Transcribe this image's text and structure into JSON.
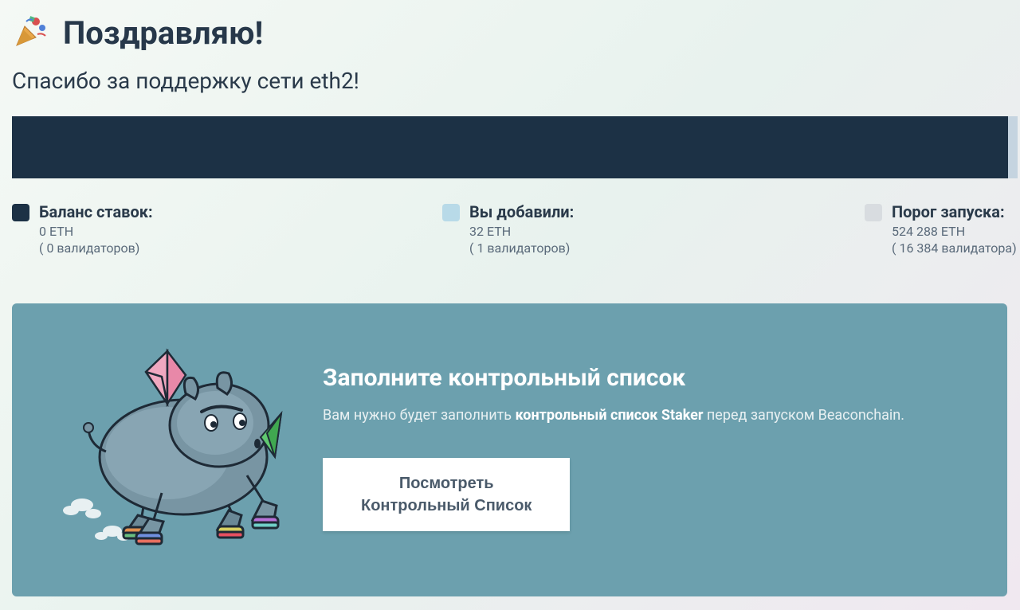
{
  "header": {
    "title": "Поздравляю!",
    "subtitle": "Спасибо за поддержку сети eth2!",
    "party_icon": "party-popper-icon"
  },
  "stats": {
    "balance": {
      "label": "Баланс ставок:",
      "value": "0 ETH",
      "detail": "( 0 валидаторов)"
    },
    "contributed": {
      "label": "Вы добавили:",
      "value": "32 ETH",
      "detail": "( 1 валидаторов)"
    },
    "threshold": {
      "label": "Порог запуска:",
      "value": "524 288 ETH",
      "detail": "( 16 384 валидатора)"
    }
  },
  "checklist": {
    "title": "Заполните контрольный список",
    "desc_prefix": "Вам нужно будет заполнить ",
    "desc_bold": "контрольный список Staker",
    "desc_suffix": " перед запуском Beaconchain.",
    "button_line1": "Посмотреть",
    "button_line2": "Контрольный Список"
  },
  "colors": {
    "progress_bg": "#1c3145",
    "card_bg": "#6ca0ae",
    "button_bg": "#ffffff"
  }
}
